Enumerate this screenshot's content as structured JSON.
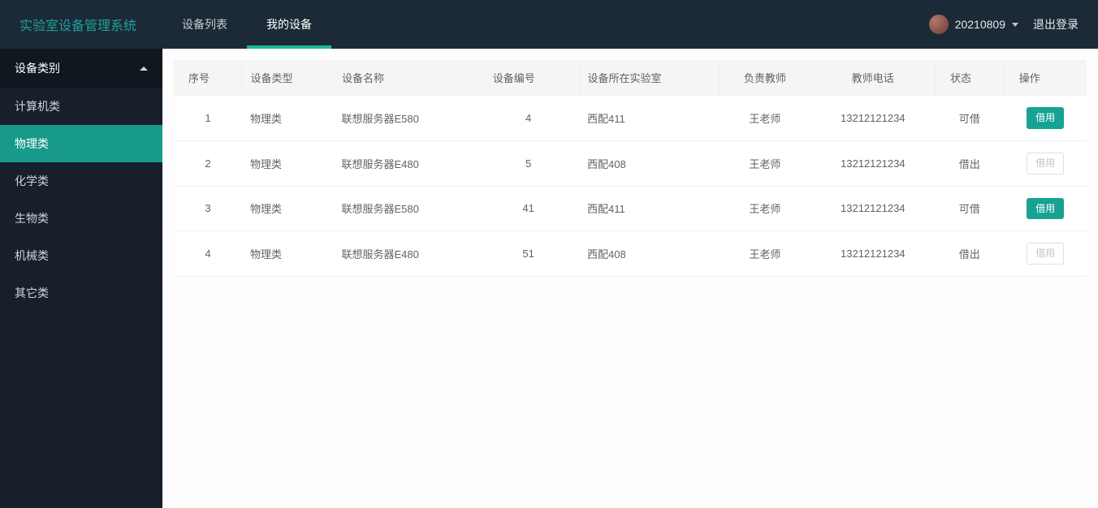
{
  "header": {
    "brand": "实验室设备管理系统",
    "tabs": [
      {
        "label": "设备列表",
        "active": false
      },
      {
        "label": "我的设备",
        "active": true
      }
    ],
    "username": "20210809",
    "logout": "退出登录"
  },
  "sidebar": {
    "title": "设备类别",
    "items": [
      {
        "label": "计算机类",
        "active": false
      },
      {
        "label": "物理类",
        "active": true
      },
      {
        "label": "化学类",
        "active": false
      },
      {
        "label": "生物类",
        "active": false
      },
      {
        "label": "机械类",
        "active": false
      },
      {
        "label": "其它类",
        "active": false
      }
    ]
  },
  "table": {
    "columns": [
      "序号",
      "设备类型",
      "设备名称",
      "设备编号",
      "设备所在实验室",
      "负责教师",
      "教师电话",
      "状态",
      "操作"
    ],
    "action_label": "借用",
    "rows": [
      {
        "index": "1",
        "type": "物理类",
        "name": "联想服务器E580",
        "code": "4",
        "lab": "西配411",
        "teacher": "王老师",
        "phone": "13212121234",
        "status": "可借",
        "action_enabled": true
      },
      {
        "index": "2",
        "type": "物理类",
        "name": "联想服务器E480",
        "code": "5",
        "lab": "西配408",
        "teacher": "王老师",
        "phone": "13212121234",
        "status": "借出",
        "action_enabled": false
      },
      {
        "index": "3",
        "type": "物理类",
        "name": "联想服务器E580",
        "code": "41",
        "lab": "西配411",
        "teacher": "王老师",
        "phone": "13212121234",
        "status": "可借",
        "action_enabled": true
      },
      {
        "index": "4",
        "type": "物理类",
        "name": "联想服务器E480",
        "code": "51",
        "lab": "西配408",
        "teacher": "王老师",
        "phone": "13212121234",
        "status": "借出",
        "action_enabled": false
      }
    ]
  }
}
